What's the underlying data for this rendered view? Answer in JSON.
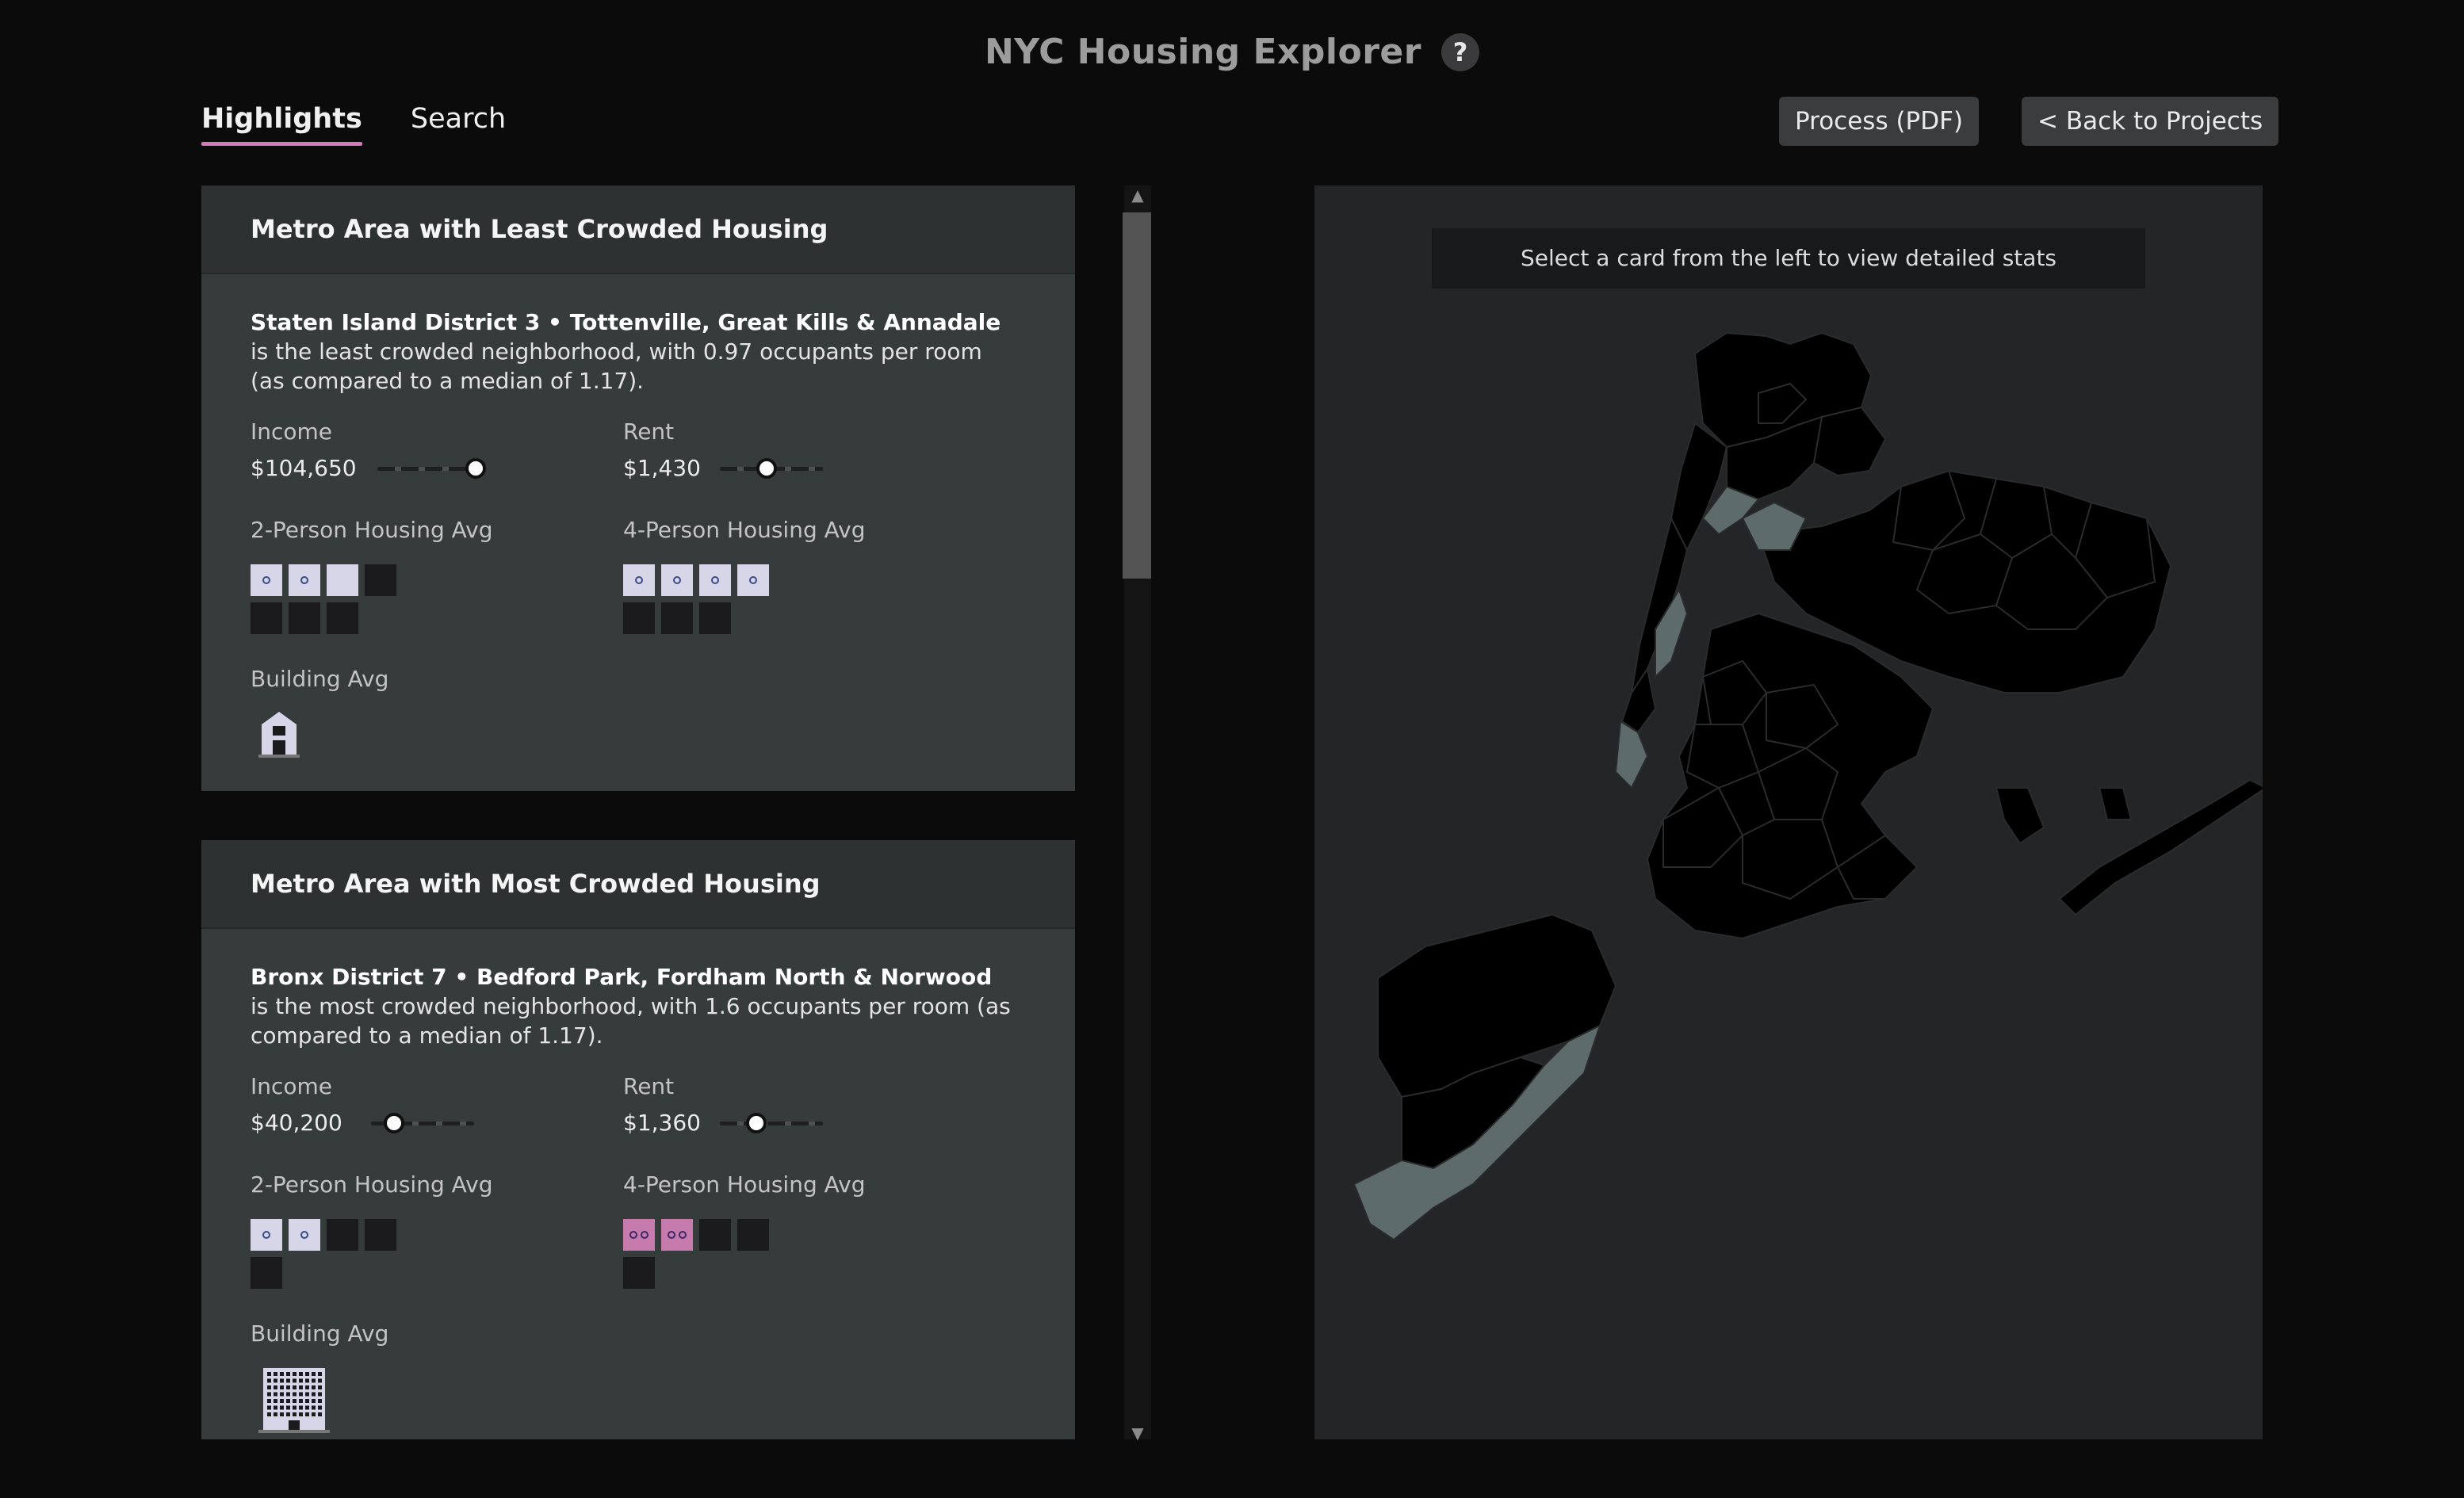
{
  "app": {
    "title": "NYC Housing Explorer",
    "help_label": "?"
  },
  "tabs": [
    {
      "label": "Highlights",
      "active": true
    },
    {
      "label": "Search",
      "active": false
    }
  ],
  "header_buttons": {
    "process": "Process (PDF)",
    "back": "< Back to Projects"
  },
  "cards": [
    {
      "title": "Metro Area with Least Crowded Housing",
      "district": "Staten Island District 3 • Tottenville, Great Kills & Annadale",
      "description": " is the least crowded neighborhood, with 0.97 occupants per room (as compared to a median of 1.17).",
      "income_label": "Income",
      "income_value": "$104,650",
      "income_level": 0.95,
      "rent_label": "Rent",
      "rent_value": "$1,430",
      "rent_level": 0.45,
      "two_person_label": "2-Person Housing Avg",
      "two_person_cells": [
        "p1",
        "p1",
        "e",
        "d",
        "d",
        "d",
        "d"
      ],
      "four_person_label": "4-Person Housing Avg",
      "four_person_cells": [
        "p1",
        "p1",
        "p1",
        "p1",
        "d",
        "d",
        "d"
      ],
      "building_label": "Building Avg",
      "building_icon": "house-icon"
    },
    {
      "title": "Metro Area with Most Crowded Housing",
      "district": "Bronx District 7 • Bedford Park, Fordham North & Norwood",
      "description": " is the most crowded neighborhood, with 1.6 occupants per room (as compared to a median of 1.17).",
      "income_label": "Income",
      "income_value": "$40,200",
      "income_level": 0.22,
      "rent_label": "Rent",
      "rent_value": "$1,360",
      "rent_level": 0.35,
      "two_person_label": "2-Person Housing Avg",
      "two_person_cells": [
        "p1",
        "p1",
        "d",
        "d",
        "d"
      ],
      "four_person_label": "4-Person Housing Avg",
      "four_person_cells": [
        "p2",
        "p2",
        "d",
        "d",
        "d"
      ],
      "building_label": "Building Avg",
      "building_icon": "apartment-building-icon"
    }
  ],
  "map": {
    "hint": "Select a card from the left to view detailed stats",
    "district_color": "#000000",
    "highlight_color": "#5e6b6b",
    "border_color": "#2a2b2c"
  },
  "colors": {
    "accent": "#d27bb8",
    "panel": "#242526",
    "card": "#363b3c"
  }
}
